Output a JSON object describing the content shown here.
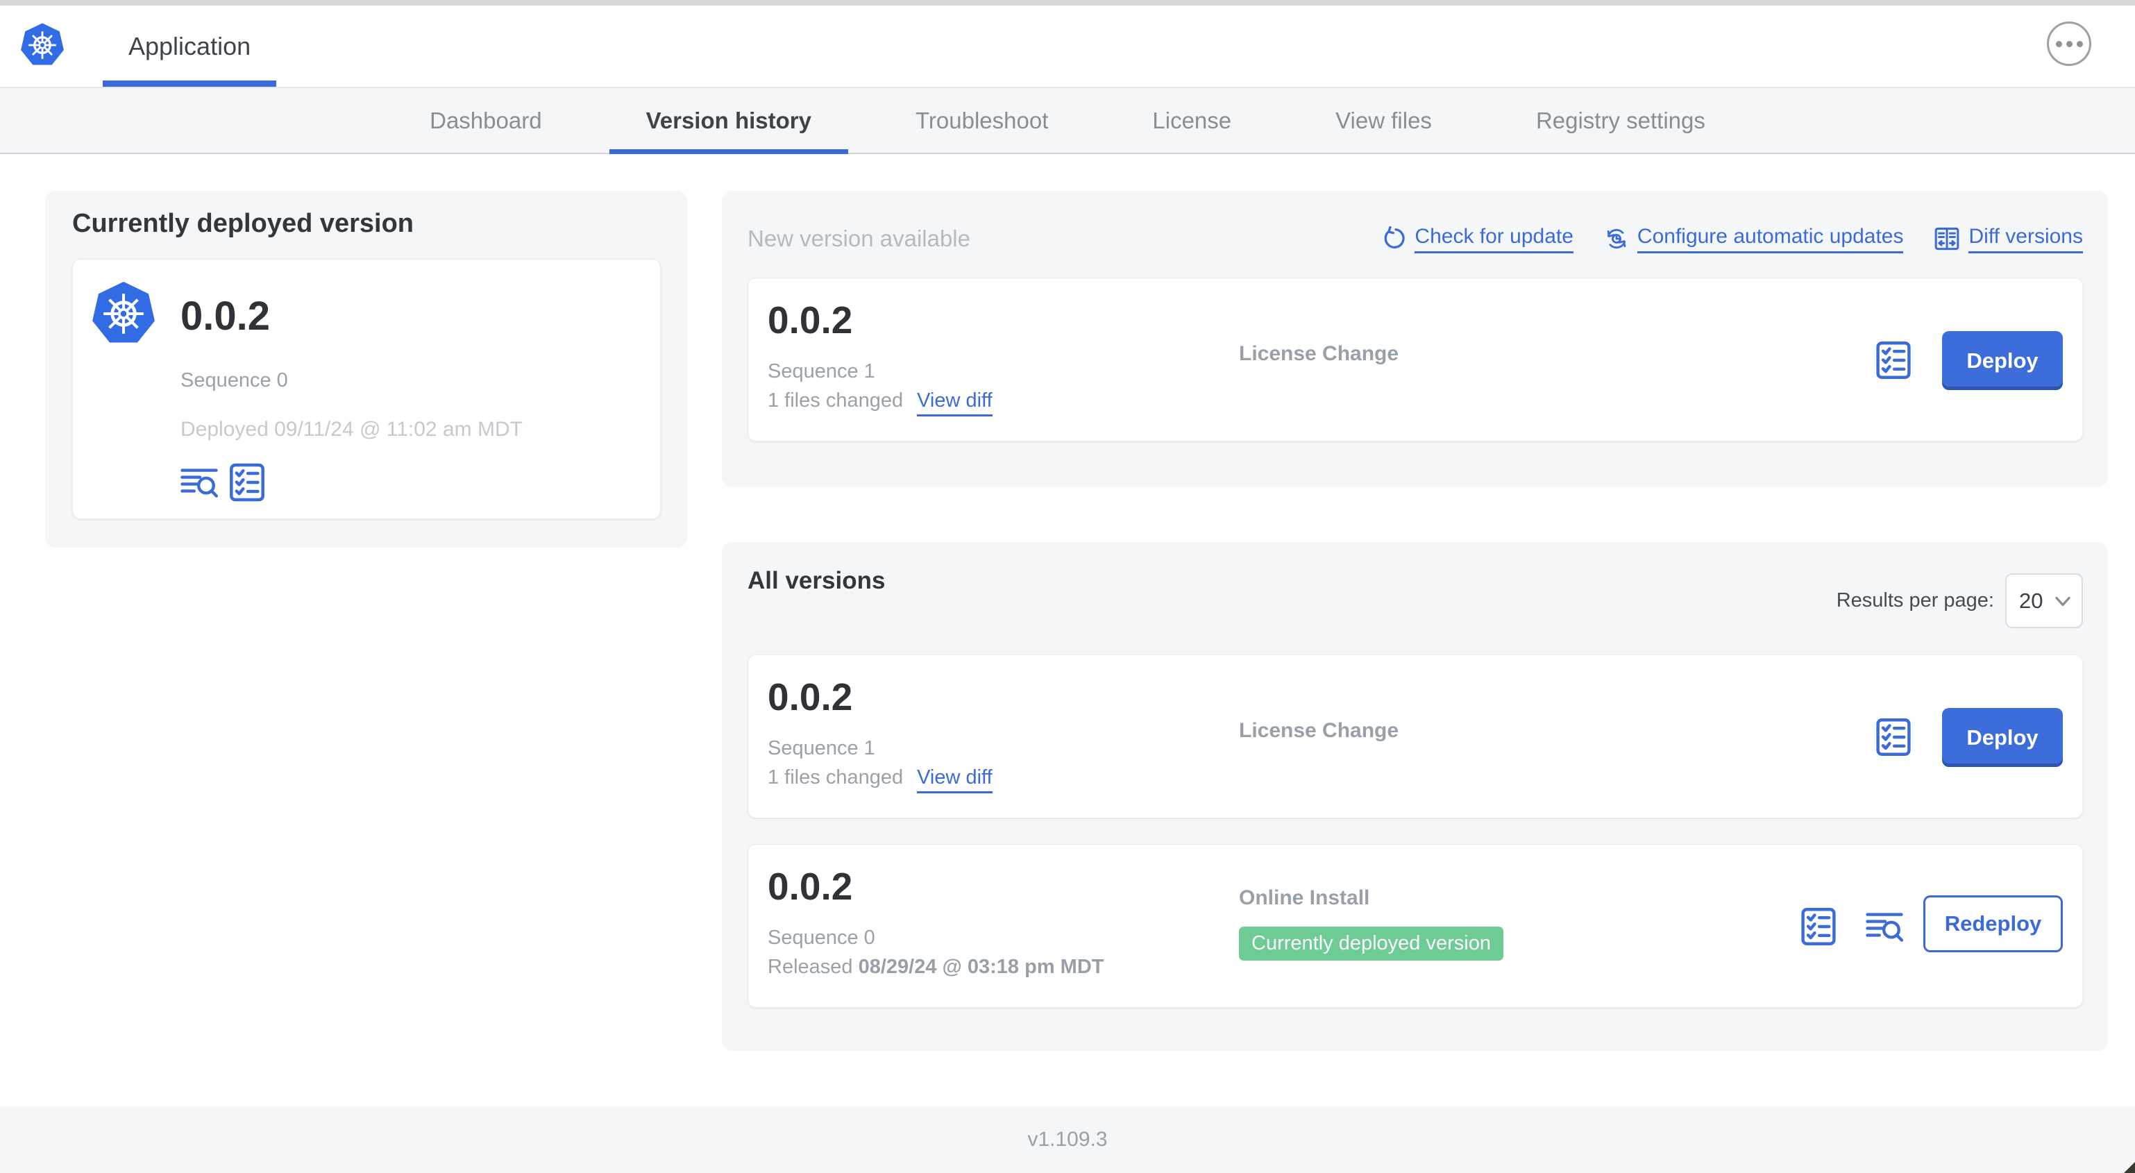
{
  "header": {
    "app_tab_label": "Application"
  },
  "nav": {
    "tabs": {
      "dashboard": "Dashboard",
      "version_history": "Version history",
      "troubleshoot": "Troubleshoot",
      "license": "License",
      "view_files": "View files",
      "registry_settings": "Registry settings"
    }
  },
  "currently_deployed": {
    "title": "Currently deployed version",
    "version": "0.0.2",
    "sequence": "Sequence 0",
    "deployed_at": "Deployed 09/11/24 @ 11:02 am MDT"
  },
  "new_version": {
    "title": "New version available",
    "check_for_update": "Check for update",
    "configure_automatic_updates": "Configure automatic updates",
    "diff_versions": "Diff versions",
    "row": {
      "version": "0.0.2",
      "sequence": "Sequence 1",
      "files_changed": "1 files changed",
      "view_diff": "View diff",
      "source": "License Change",
      "action": "Deploy"
    }
  },
  "all_versions": {
    "title": "All versions",
    "results_per_page_label": "Results per page:",
    "results_per_page_value": "20",
    "rows": [
      {
        "version": "0.0.2",
        "sequence": "Sequence 1",
        "files_changed": "1 files changed",
        "view_diff": "View diff",
        "source": "License Change",
        "action": "Deploy"
      },
      {
        "version": "0.0.2",
        "sequence": "Sequence 0",
        "released_prefix": "Released",
        "released_date": "08/29/24 @ 03:18 pm MDT",
        "source": "Online Install",
        "badge": "Currently deployed version",
        "action": "Redeploy"
      }
    ]
  },
  "footer": {
    "app_version": "v1.109.3"
  },
  "colors": {
    "primary_blue": "#3b6bd8",
    "kubernetes_blue": "#326ce5",
    "badge_green": "#6dcb94"
  }
}
